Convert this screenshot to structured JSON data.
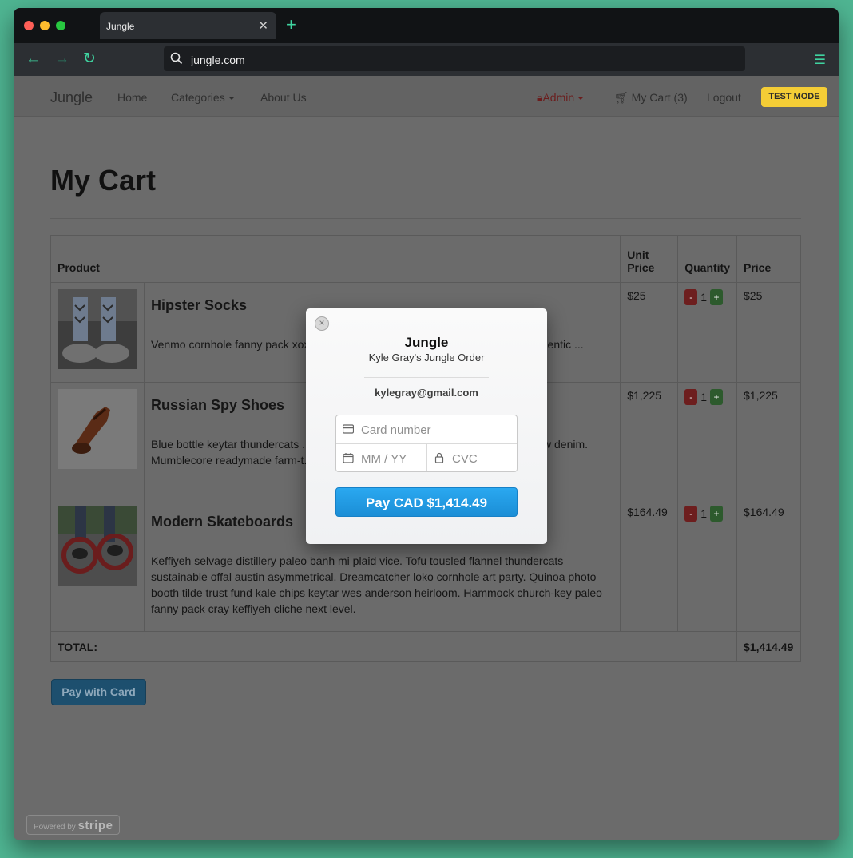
{
  "browser": {
    "tab_title": "Jungle",
    "url": "jungle.com"
  },
  "navbar": {
    "brand": "Jungle",
    "home": "Home",
    "categories": "Categories",
    "about": "About Us",
    "admin": "Admin",
    "cart": "My Cart (3)",
    "logout": "Logout",
    "test_mode": "TEST MODE"
  },
  "page": {
    "title": "My Cart"
  },
  "table": {
    "headers": {
      "product": "Product",
      "unit_price_line1": "Unit",
      "unit_price_line2": "Price",
      "quantity": "Quantity",
      "price": "Price"
    },
    "rows": [
      {
        "name": "Hipster Socks",
        "description": "Venmo cornhole fanny pack xoxo ... messenger bag. Sustainable roof loko. Authentic ...",
        "unit_price": "$25",
        "quantity": "1",
        "price": "$25"
      },
      {
        "name": "Russian Spy Shoes",
        "description": "Blue bottle keytar thundercats ... chic irony typewriter pour-over. Whatever ... raw denim. Mumblecore readymade farm-t... che.",
        "unit_price": "$1,225",
        "quantity": "1",
        "price": "$1,225"
      },
      {
        "name": "Modern Skateboards",
        "description": "Keffiyeh selvage distillery paleo banh mi plaid vice. Tofu tousled flannel thundercats sustainable offal austin asymmetrical. Dreamcatcher loko cornhole art party. Quinoa photo booth tilde trust fund kale chips keytar wes anderson heirloom. Hammock church-key paleo fanny pack cray keffiyeh cliche next level.",
        "unit_price": "$164.49",
        "quantity": "1",
        "price": "$164.49"
      }
    ],
    "qty_minus": "-",
    "qty_plus": "+",
    "total_label": "TOTAL:",
    "total_value": "$1,414.49"
  },
  "pay_button": "Pay with Card",
  "powered_by": {
    "prefix": "Powered by",
    "brand": "stripe"
  },
  "checkout_modal": {
    "close": "×",
    "title": "Jungle",
    "subtitle": "Kyle Gray's Jungle Order",
    "email": "kylegray@gmail.com",
    "card_number_placeholder": "Card number",
    "expiry_placeholder": "MM / YY",
    "cvc_placeholder": "CVC",
    "pay_label": "Pay CAD $1,414.49"
  },
  "colors": {
    "accent": "#3fd4a0",
    "test_mode": "#f4cd36",
    "pay_button": "#1b8ed6"
  }
}
